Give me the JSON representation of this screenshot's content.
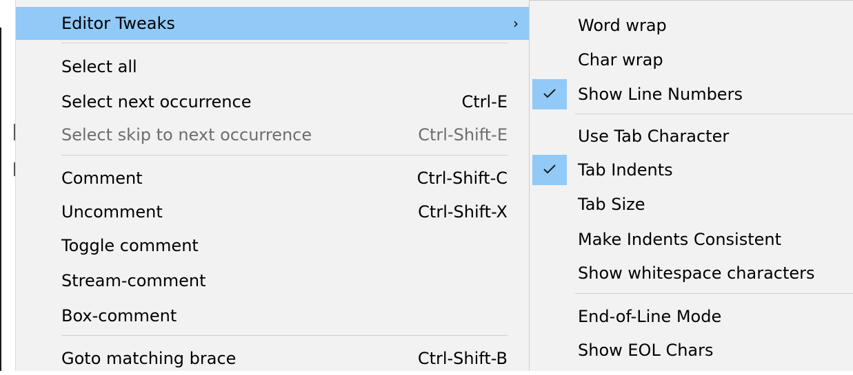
{
  "main_menu": {
    "items": [
      {
        "label": "Editor Tweaks",
        "shortcut": "",
        "arrow": "›"
      },
      {
        "label": "Select all",
        "shortcut": ""
      },
      {
        "label": "Select next occurrence",
        "shortcut": "Ctrl-E"
      },
      {
        "label": "Select skip to next occurrence",
        "shortcut": "Ctrl-Shift-E"
      },
      {
        "label": "Comment",
        "shortcut": "Ctrl-Shift-C"
      },
      {
        "label": "Uncomment",
        "shortcut": "Ctrl-Shift-X"
      },
      {
        "label": "Toggle comment",
        "shortcut": ""
      },
      {
        "label": "Stream-comment",
        "shortcut": ""
      },
      {
        "label": "Box-comment",
        "shortcut": ""
      },
      {
        "label": "Goto matching brace",
        "shortcut": "Ctrl-Shift-B"
      }
    ]
  },
  "sub_menu": {
    "items": [
      {
        "label": "Word wrap",
        "checked": false
      },
      {
        "label": "Char wrap",
        "checked": false
      },
      {
        "label": "Show Line Numbers",
        "checked": true
      },
      {
        "label": "Use Tab Character",
        "checked": false
      },
      {
        "label": "Tab Indents",
        "checked": true
      },
      {
        "label": "Tab Size",
        "checked": false
      },
      {
        "label": "Make Indents Consistent",
        "checked": false
      },
      {
        "label": "Show whitespace characters",
        "checked": false
      },
      {
        "label": "End-of-Line Mode",
        "checked": false
      },
      {
        "label": "Show EOL Chars",
        "checked": false
      }
    ]
  },
  "colors": {
    "highlight": "#91c9f7",
    "menu_background": "#f2f2f2",
    "disabled_text": "#6d6d6d"
  }
}
